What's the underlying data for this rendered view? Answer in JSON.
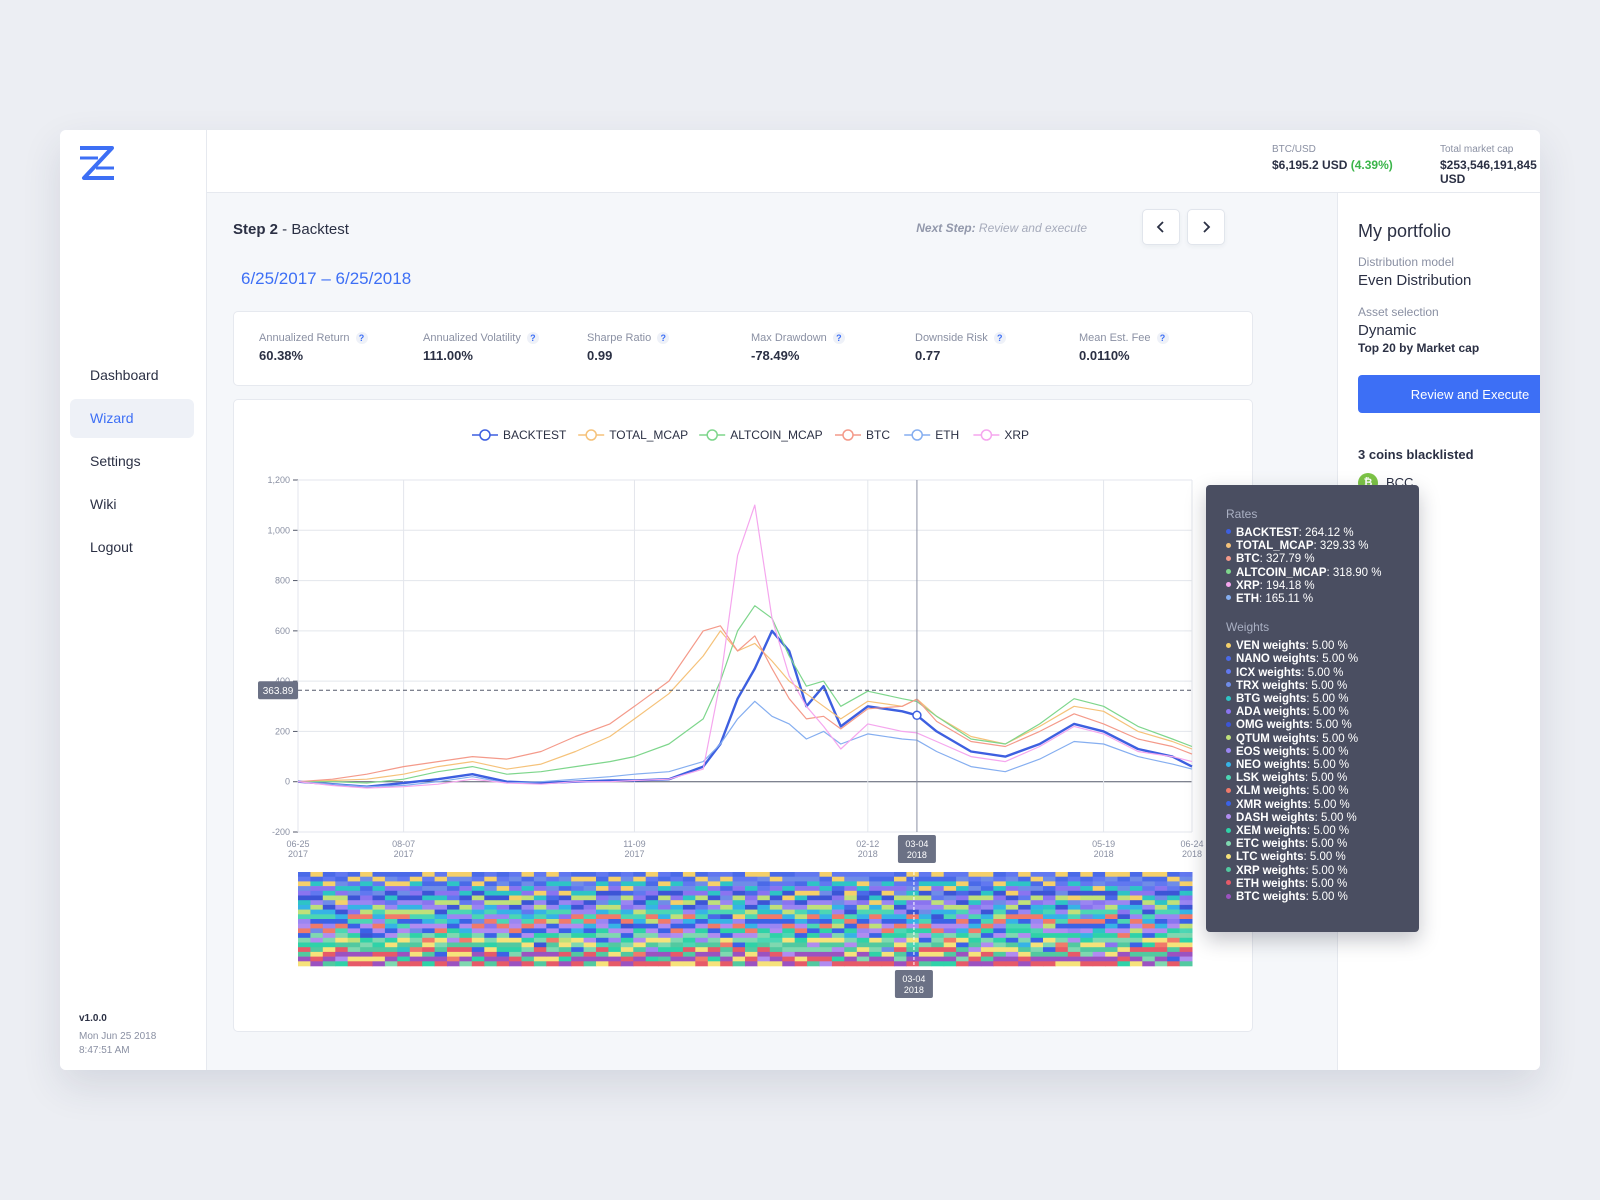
{
  "app": {
    "version": "v1.0.0",
    "date_line1": "Mon Jun 25 2018",
    "date_line2": "8:47:51 AM",
    "logo_icon": "zipper-logo-icon"
  },
  "nav": {
    "items": [
      {
        "label": "Dashboard",
        "active": false
      },
      {
        "label": "Wizard",
        "active": true
      },
      {
        "label": "Settings",
        "active": false
      },
      {
        "label": "Wiki",
        "active": false
      },
      {
        "label": "Logout",
        "active": false
      }
    ]
  },
  "topbar": {
    "btc_label": "BTC/USD",
    "btc_value": "$6,195.2 USD",
    "btc_change": "(4.39%)",
    "mcap_label": "Total market cap",
    "mcap_value": "$253,546,191,845 USD"
  },
  "step": {
    "title_bold": "Step 2",
    "title_rest": " - Backtest",
    "next_label": "Next Step:",
    "next_value": " Review and execute",
    "date_range": "6/25/2017 – 6/25/2018"
  },
  "metrics": [
    {
      "label": "Annualized Return",
      "value": "60.38%"
    },
    {
      "label": "Annualized Volatility",
      "value": "111.00%"
    },
    {
      "label": "Sharpe Ratio",
      "value": "0.99"
    },
    {
      "label": "Max Drawdown",
      "value": "-78.49%"
    },
    {
      "label": "Downside Risk",
      "value": "0.77"
    },
    {
      "label": "Mean Est. Fee",
      "value": "0.0110%"
    }
  ],
  "chart_data": {
    "type": "line",
    "xlabel": "",
    "ylabel": "",
    "ylim": [
      -200,
      1200
    ],
    "yticks": [
      -200,
      0,
      200,
      400,
      600,
      800,
      "1,000",
      "1,200"
    ],
    "grid": true,
    "legend_position": "top",
    "x_ticks": [
      {
        "date": "06-25",
        "year": "2017"
      },
      {
        "date": "08-07",
        "year": "2017"
      },
      {
        "date": "11-09",
        "year": "2017"
      },
      {
        "date": "02-12",
        "year": "2018"
      },
      {
        "date": "05-19",
        "year": "2018"
      },
      {
        "date": "06-24",
        "year": "2018"
      }
    ],
    "x_dates": [
      "2017-06-25",
      "2017-07-09",
      "2017-07-23",
      "2017-08-07",
      "2017-08-21",
      "2017-09-04",
      "2017-09-18",
      "2017-10-02",
      "2017-10-16",
      "2017-10-30",
      "2017-11-09",
      "2017-11-23",
      "2017-12-07",
      "2017-12-14",
      "2017-12-21",
      "2017-12-28",
      "2018-01-04",
      "2018-01-11",
      "2018-01-18",
      "2018-01-25",
      "2018-02-01",
      "2018-02-12",
      "2018-02-26",
      "2018-03-04",
      "2018-03-12",
      "2018-03-26",
      "2018-04-09",
      "2018-04-23",
      "2018-05-07",
      "2018-05-19",
      "2018-06-02",
      "2018-06-16",
      "2018-06-24"
    ],
    "crosshair": {
      "x_label": "03-04",
      "x_year": "2018",
      "y_label": "363.89"
    },
    "series": [
      {
        "name": "BACKTEST",
        "color": "#3d5fe0",
        "values": [
          0,
          -10,
          -20,
          -5,
          10,
          30,
          0,
          -5,
          0,
          5,
          5,
          10,
          60,
          150,
          330,
          450,
          600,
          520,
          300,
          380,
          220,
          300,
          280,
          264,
          200,
          120,
          100,
          150,
          230,
          200,
          130,
          100,
          60
        ]
      },
      {
        "name": "TOTAL_MCAP",
        "color": "#f5c27a",
        "values": [
          0,
          5,
          10,
          30,
          60,
          80,
          50,
          70,
          120,
          180,
          250,
          350,
          500,
          600,
          520,
          550,
          480,
          400,
          350,
          300,
          250,
          320,
          300,
          329,
          260,
          180,
          150,
          220,
          300,
          280,
          200,
          160,
          130
        ]
      },
      {
        "name": "ALTCOIN_MCAP",
        "color": "#7ed68c",
        "values": [
          0,
          0,
          -5,
          10,
          40,
          60,
          30,
          40,
          60,
          80,
          100,
          150,
          250,
          400,
          600,
          700,
          650,
          500,
          380,
          400,
          300,
          360,
          330,
          319,
          260,
          170,
          150,
          230,
          330,
          300,
          220,
          170,
          140
        ]
      },
      {
        "name": "BTC",
        "color": "#f49a8a",
        "values": [
          0,
          10,
          30,
          60,
          80,
          100,
          90,
          120,
          180,
          230,
          300,
          400,
          600,
          620,
          520,
          580,
          450,
          330,
          250,
          260,
          210,
          290,
          300,
          328,
          240,
          160,
          140,
          200,
          270,
          230,
          170,
          140,
          110
        ]
      },
      {
        "name": "ETH",
        "color": "#85aef0",
        "values": [
          0,
          -10,
          -20,
          -15,
          0,
          20,
          -5,
          0,
          10,
          20,
          30,
          40,
          80,
          150,
          250,
          320,
          260,
          230,
          170,
          200,
          150,
          190,
          170,
          165,
          120,
          60,
          40,
          90,
          160,
          150,
          100,
          70,
          50
        ]
      },
      {
        "name": "XRP",
        "color": "#f5a6ee",
        "values": [
          0,
          -15,
          -25,
          -20,
          -10,
          10,
          -5,
          -10,
          0,
          0,
          5,
          10,
          50,
          400,
          900,
          1100,
          650,
          420,
          300,
          220,
          130,
          230,
          200,
          194,
          160,
          100,
          80,
          140,
          220,
          190,
          120,
          100,
          80
        ]
      }
    ]
  },
  "tooltip": {
    "rates_label": "Rates",
    "rates": [
      {
        "name": "BACKTEST",
        "value": "264.12 %",
        "color": "#3d5fe0"
      },
      {
        "name": "TOTAL_MCAP",
        "value": "329.33 %",
        "color": "#f5c27a"
      },
      {
        "name": "BTC",
        "value": "327.79 %",
        "color": "#f49a8a"
      },
      {
        "name": "ALTCOIN_MCAP",
        "value": "318.90 %",
        "color": "#7ed68c"
      },
      {
        "name": "XRP",
        "value": "194.18 %",
        "color": "#f5a6ee"
      },
      {
        "name": "ETH",
        "value": "165.11 %",
        "color": "#85aef0"
      }
    ],
    "weights_label": "Weights",
    "weights": [
      {
        "name": "VEN weights",
        "value": "5.00 %",
        "color": "#f5d06a"
      },
      {
        "name": "NANO weights",
        "value": "5.00 %",
        "color": "#4a6ae8"
      },
      {
        "name": "ICX weights",
        "value": "5.00 %",
        "color": "#6178f0"
      },
      {
        "name": "TRX weights",
        "value": "5.00 %",
        "color": "#6f8ce8"
      },
      {
        "name": "BTG weights",
        "value": "5.00 %",
        "color": "#2ec4c6"
      },
      {
        "name": "ADA weights",
        "value": "5.00 %",
        "color": "#8a74f0"
      },
      {
        "name": "OMG weights",
        "value": "5.00 %",
        "color": "#3c55d6"
      },
      {
        "name": "QTUM weights",
        "value": "5.00 %",
        "color": "#bfe07a"
      },
      {
        "name": "EOS weights",
        "value": "5.00 %",
        "color": "#9a86f2"
      },
      {
        "name": "NEO weights",
        "value": "5.00 %",
        "color": "#36b3e6"
      },
      {
        "name": "LSK weights",
        "value": "5.00 %",
        "color": "#4cd6b4"
      },
      {
        "name": "XLM weights",
        "value": "5.00 %",
        "color": "#f07a6a"
      },
      {
        "name": "XMR weights",
        "value": "5.00 %",
        "color": "#3b62e6"
      },
      {
        "name": "DASH weights",
        "value": "5.00 %",
        "color": "#b08cf0"
      },
      {
        "name": "XEM weights",
        "value": "5.00 %",
        "color": "#2fd2a8"
      },
      {
        "name": "ETC weights",
        "value": "5.00 %",
        "color": "#7fd8b0"
      },
      {
        "name": "LTC weights",
        "value": "5.00 %",
        "color": "#f6e27a"
      },
      {
        "name": "XRP weights",
        "value": "5.00 %",
        "color": "#52c9a0"
      },
      {
        "name": "ETH weights",
        "value": "5.00 %",
        "color": "#e65a68"
      },
      {
        "name": "BTC weights",
        "value": "5.00 %",
        "color": "#9b52c0"
      }
    ]
  },
  "portfolio": {
    "title": "My portfolio",
    "dist_label": "Distribution model",
    "dist_value": "Even Distribution",
    "asset_label": "Asset selection",
    "asset_value": "Dynamic",
    "asset_sub": "Top 20 by Market cap",
    "button_label": "Review and Execute",
    "blacklist_title": "3 coins blacklisted",
    "blacklist": [
      {
        "name": "BCC",
        "icon": "bitcoin-cash-icon"
      },
      {
        "name": "",
        "icon": "coin-icon"
      },
      {
        "name": "",
        "icon": "coin-icon"
      }
    ]
  }
}
